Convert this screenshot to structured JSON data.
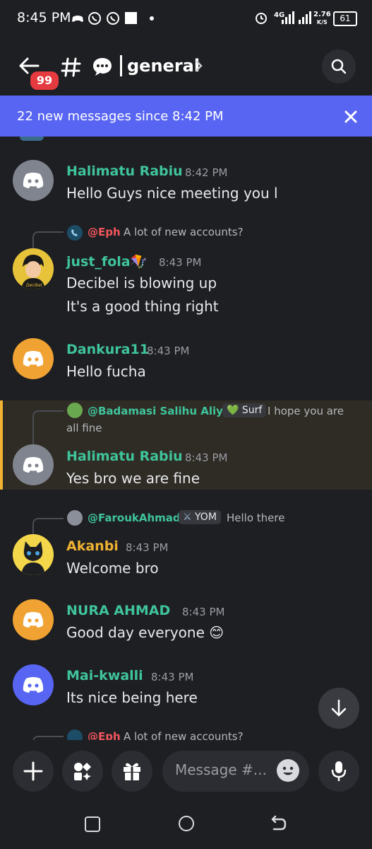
{
  "status_bar": {
    "time": "8:45 PM",
    "network": "4G",
    "speed_value": "2.76",
    "speed_unit": "K/S",
    "battery": "61"
  },
  "header": {
    "unread_badge": "99",
    "channel_name": "general"
  },
  "banner": {
    "text": "22 new messages since 8:42 PM"
  },
  "messages": [
    {
      "author": "Halimatu Rabiu",
      "time": "8:42 PM",
      "lines": [
        "Hello Guys nice meeting you l"
      ]
    },
    {
      "reply_to": "@Eph",
      "reply_text": "A lot of new accounts?",
      "author": "just_fola🪁",
      "time": "8:43 PM",
      "lines": [
        "Decibel is blowing up",
        "It's a good thing right"
      ]
    },
    {
      "author": "Dankura11",
      "time": "8:43 PM",
      "lines": [
        "Hello fucha"
      ]
    },
    {
      "reply_to": "@Badamasi Salihu Aliyu",
      "reply_tag": "Surf",
      "reply_text": "I hope you are",
      "reply_text_2": "all fine",
      "author": "Halimatu Rabiu",
      "time": "8:43 PM",
      "lines": [
        "Yes bro we are fine"
      ]
    },
    {
      "reply_to": "@FaroukAhmad",
      "reply_tag": "YOM",
      "reply_text": "Hello there",
      "author": "Akanbi",
      "time": "8:43 PM",
      "lines": [
        "Welcome bro"
      ]
    },
    {
      "author": "NURA AHMAD",
      "time": "8:43 PM",
      "lines": [
        "Good day everyone 😊"
      ]
    },
    {
      "author": "Mai-kwalli",
      "time": "8:43 PM",
      "lines": [
        "Its nice being here"
      ]
    },
    {
      "reply_to": "@Eph",
      "reply_text": "A lot of new accounts?"
    }
  ],
  "composer": {
    "placeholder": "Message #..."
  },
  "colors": {
    "background": "#1e1f23",
    "blurple": "#5865f2",
    "username_green": "#3fc49b",
    "username_gold": "#f0b232",
    "mention_red": "#f0565c",
    "highlight_bg": "#2f2c25"
  },
  "icons": [
    "back-arrow-icon",
    "hash-icon",
    "speech-bubble-icon",
    "chevron-right-icon",
    "search-icon",
    "close-icon",
    "discord-logo-icon",
    "arrow-down-icon",
    "plus-icon",
    "apps-icon",
    "gift-icon",
    "smiley-icon",
    "microphone-icon",
    "square-nav-icon",
    "circle-nav-icon",
    "back-nav-icon"
  ]
}
